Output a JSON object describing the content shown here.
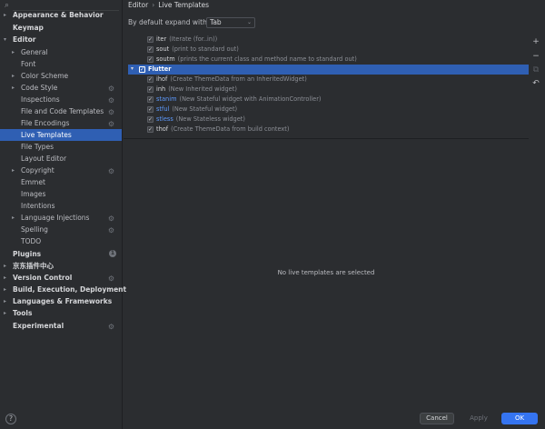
{
  "sidebar": {
    "search_icon": "⌕",
    "items": [
      {
        "label": "Appearance & Behavior",
        "arrow": "▸",
        "bold": true
      },
      {
        "label": "Keymap",
        "bold": true
      },
      {
        "label": "Editor",
        "arrow": "▾",
        "bold": true
      },
      {
        "label": "General",
        "arrow": "▸"
      },
      {
        "label": "Font"
      },
      {
        "label": "Color Scheme",
        "arrow": "▸"
      },
      {
        "label": "Code Style",
        "arrow": "▸",
        "gear": "⚙"
      },
      {
        "label": "Inspections",
        "gear": "⚙"
      },
      {
        "label": "File and Code Templates",
        "gear": "⚙"
      },
      {
        "label": "File Encodings",
        "gear": "⚙"
      },
      {
        "label": "Live Templates",
        "selected": true
      },
      {
        "label": "File Types"
      },
      {
        "label": "Layout Editor"
      },
      {
        "label": "Copyright",
        "arrow": "▸",
        "gear": "⚙"
      },
      {
        "label": "Emmet"
      },
      {
        "label": "Images"
      },
      {
        "label": "Intentions"
      },
      {
        "label": "Language Injections",
        "arrow": "▸",
        "gear": "⚙"
      },
      {
        "label": "Spelling",
        "gear": "⚙"
      },
      {
        "label": "TODO"
      },
      {
        "label": "Plugins",
        "bold": true,
        "badge": "1"
      },
      {
        "label": "京东插件中心",
        "arrow": "▸",
        "bold": true
      },
      {
        "label": "Version Control",
        "arrow": "▸",
        "bold": true,
        "gear": "⚙"
      },
      {
        "label": "Build, Execution, Deployment",
        "arrow": "▸",
        "bold": true
      },
      {
        "label": "Languages & Frameworks",
        "arrow": "▸",
        "bold": true
      },
      {
        "label": "Tools",
        "arrow": "▸",
        "bold": true
      },
      {
        "label": "Experimental",
        "bold": true,
        "gear": "⚙"
      }
    ],
    "help": "?"
  },
  "breadcrumb": {
    "parent": "Editor",
    "sep": "›",
    "current": "Live Templates"
  },
  "expand": {
    "label": "By default expand with",
    "value": "Tab",
    "chevron": "⌄"
  },
  "templates": [
    {
      "abbr": "iter",
      "desc": "(Iterate (for..in))",
      "check": "✓"
    },
    {
      "abbr": "sout",
      "desc": "(print to standard out)",
      "check": "✓"
    },
    {
      "abbr": "soutm",
      "desc": "(prints the current class and method name to standard out)",
      "check": "✓"
    },
    {
      "abbr": "Flutter",
      "desc": "",
      "check": "✓",
      "group": true,
      "arrow": "▾"
    },
    {
      "abbr": "ihof",
      "desc": "(Create ThemeData from an InheritedWidget)",
      "check": "✓"
    },
    {
      "abbr": "inh",
      "desc": "(New Inherited widget)",
      "check": "✓"
    },
    {
      "abbr": "stanim",
      "desc": "(New Stateful widget with AnimationController)",
      "check": "✓",
      "changed": true
    },
    {
      "abbr": "stful",
      "desc": "(New Stateful widget)",
      "check": "✓",
      "changed": true
    },
    {
      "abbr": "stless",
      "desc": "(New Stateless widget)",
      "check": "✓",
      "changed": true
    },
    {
      "abbr": "thof",
      "desc": "(Create ThemeData from build context)",
      "check": "✓"
    }
  ],
  "toolbar": {
    "add": "+",
    "remove": "−",
    "copy": "⧉",
    "restore": "↶"
  },
  "empty_message": "No live templates are selected",
  "footer": {
    "cancel": "Cancel",
    "apply": "Apply",
    "ok": "OK"
  },
  "colors": {
    "accent": "#3574f0",
    "selection": "#2f5fb3",
    "changed": "#5e9bff",
    "background": "#2b2d30"
  }
}
